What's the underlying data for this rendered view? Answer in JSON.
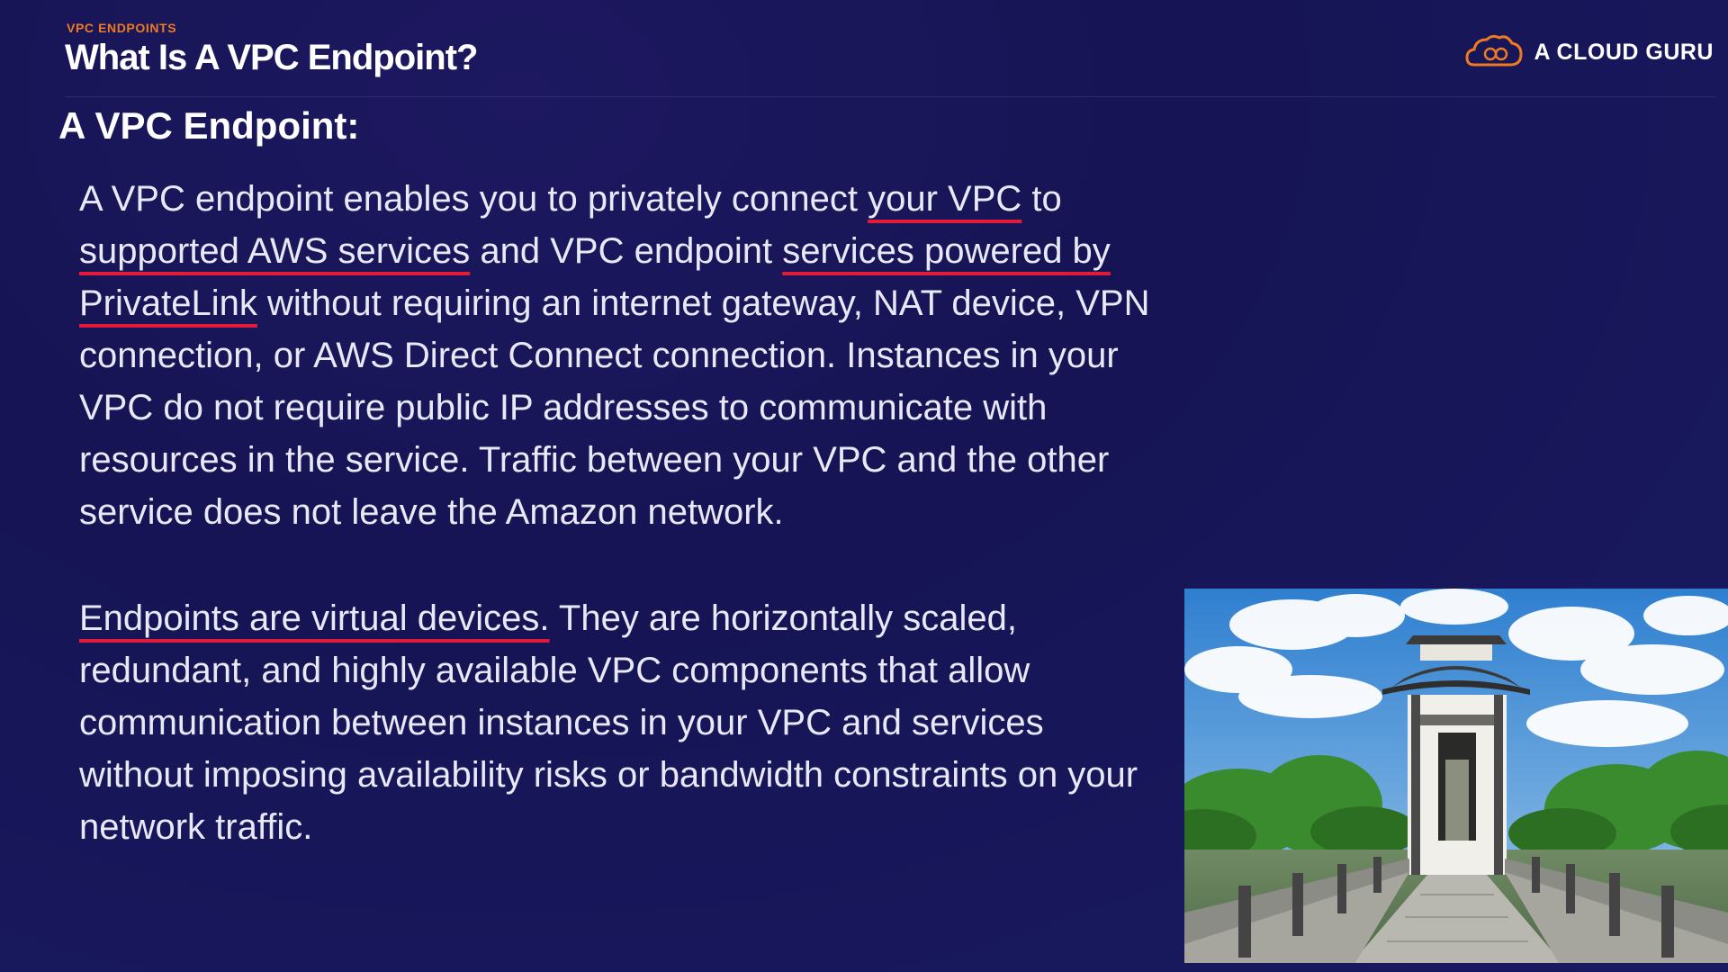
{
  "header": {
    "eyebrow": "VPC ENDPOINTS",
    "title": "What Is A VPC Endpoint?",
    "brand_name": "A CLOUD GURU",
    "brand_icon": "cloud-logo-icon",
    "accent_color": "#ef7a22"
  },
  "content": {
    "heading": "A VPC Endpoint:",
    "paragraph1": {
      "t1": "A VPC endpoint enables you to privately connect ",
      "u1": "your VPC",
      "t2": " to ",
      "u2": "supported AWS services",
      "t3": " and VPC endpoint ",
      "u3": "services powered by PrivateLink",
      "t4": " without requiring an internet gateway, NAT device, VPN connection, or AWS Direct Connect connection. Instances in your VPC do not require public IP addresses to communicate with resources in the service. Traffic between your VPC and the other service does not leave the Amazon network."
    },
    "paragraph2": {
      "u1": "Endpoints are virtual devices.",
      "t1": " They are horizontally scaled, redundant, and highly available VPC components that allow communication between instances in your VPC and services without imposing availability risks or bandwidth constraints on your network traffic."
    },
    "underline_color": "#e21b3a"
  },
  "image": {
    "subject": "chinese-pavilion-bridge-photo"
  }
}
